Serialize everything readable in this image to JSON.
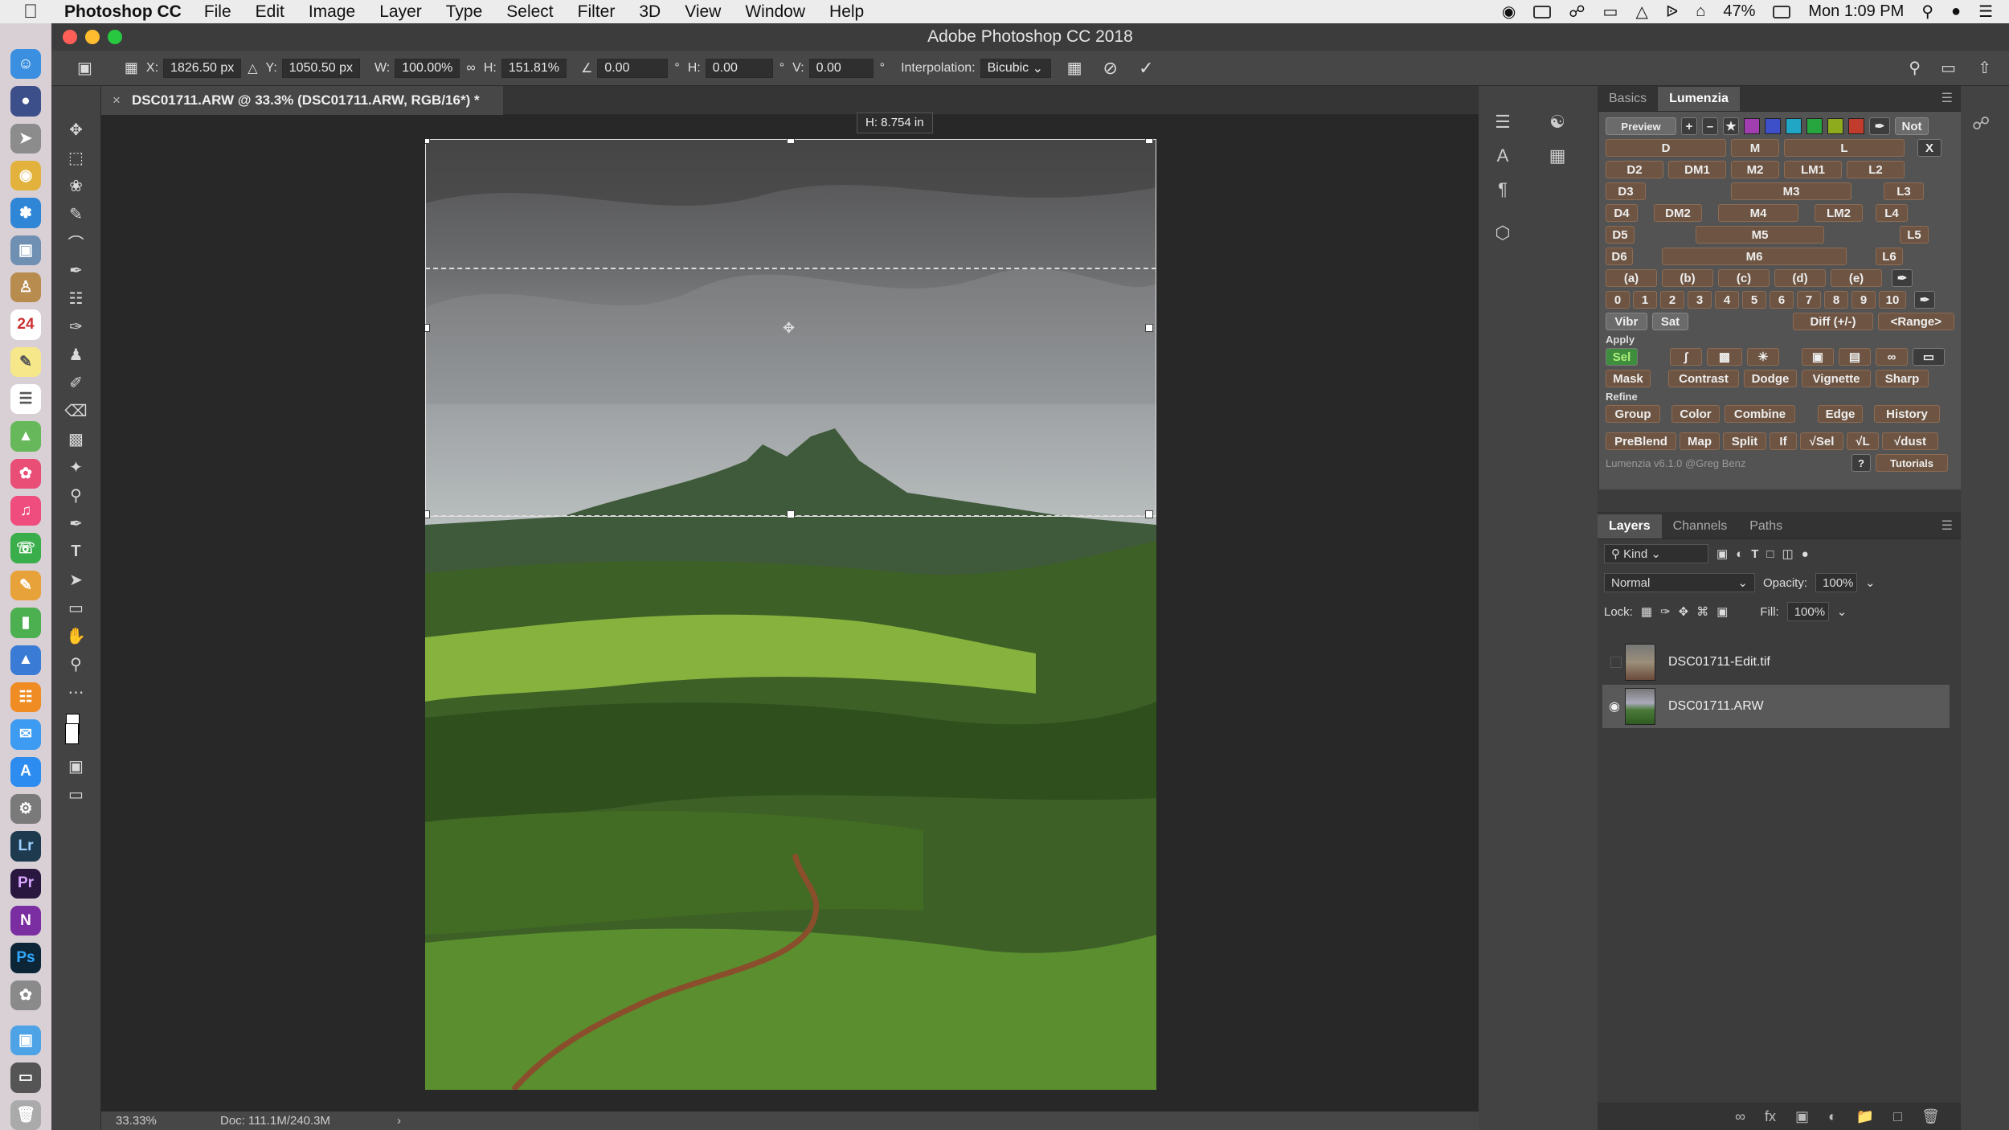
{
  "menubar": {
    "app": "Photoshop CC",
    "items": [
      "File",
      "Edit",
      "Image",
      "Layer",
      "Type",
      "Select",
      "Filter",
      "3D",
      "View",
      "Window",
      "Help"
    ],
    "battery": "47%",
    "clock": "Mon 1:09 PM"
  },
  "window": {
    "title": "Adobe Photoshop CC 2018"
  },
  "options": {
    "x_label": "X:",
    "x_value": "1826.50 px",
    "y_label": "Y:",
    "y_value": "1050.50 px",
    "w_label": "W:",
    "w_value": "100.00%",
    "h_label": "H:",
    "h_value": "151.81%",
    "angle_value": "0.00",
    "hskew_label": "H:",
    "hskew_value": "0.00",
    "vskew_label": "V:",
    "vskew_value": "0.00",
    "interp_label": "Interpolation:",
    "interp_value": "Bicubic"
  },
  "doc_tab": {
    "label": "DSC01711.ARW @ 33.3% (DSC01711.ARW, RGB/16*) *"
  },
  "tooltip": "H: 8.754 in",
  "status": {
    "zoom": "33.33%",
    "doc": "Doc: 111.1M/240.3M"
  },
  "panel_tabs": [
    "Basics",
    "Lumenzia"
  ],
  "lumenzia": {
    "preview": "Preview",
    "not": "Not",
    "x": "X",
    "row1": [
      "D",
      "M",
      "L"
    ],
    "row2": [
      "D2",
      "DM1",
      "M2",
      "LM1",
      "L2"
    ],
    "row3": [
      "D3",
      "M3",
      "L3"
    ],
    "row4": [
      "D4",
      "DM2",
      "M4",
      "LM2",
      "L4"
    ],
    "row5": [
      "D5",
      "M5",
      "L5"
    ],
    "row6": [
      "D6",
      "M6",
      "L6"
    ],
    "zones": [
      "(a)",
      "(b)",
      "(c)",
      "(d)",
      "(e)"
    ],
    "nums": [
      "0",
      "1",
      "2",
      "3",
      "4",
      "5",
      "6",
      "7",
      "8",
      "9",
      "10"
    ],
    "vibr": "Vibr",
    "sat": "Sat",
    "diff": "Diff (+/-)",
    "range": "<Range>",
    "apply_label": "Apply",
    "sel": "Sel",
    "apply2": [
      "Mask",
      "Contrast",
      "Dodge",
      "Vignette",
      "Sharp"
    ],
    "refine_label": "Refine",
    "refine": [
      "Group",
      "Color",
      "Combine",
      "Edge",
      "History"
    ],
    "bottom": [
      "PreBlend",
      "Map",
      "Split",
      "If",
      "√Sel",
      "√L",
      "√dust"
    ],
    "version": "Lumenzia v6.1.0 @Greg Benz",
    "help": "?",
    "tutorials": "Tutorials",
    "colors": [
      "#a23fb0",
      "#3d4fc9",
      "#21a6c6",
      "#27a53e",
      "#8dab1d",
      "#c23c2e"
    ]
  },
  "layers_panel": {
    "tabs": [
      "Layers",
      "Channels",
      "Paths"
    ],
    "kind": "Kind",
    "blend": "Normal",
    "opacity_label": "Opacity:",
    "opacity": "100%",
    "lock_label": "Lock:",
    "fill_label": "Fill:",
    "fill": "100%",
    "layers": [
      {
        "name": "DSC01711-Edit.tif"
      },
      {
        "name": "DSC01711.ARW"
      }
    ]
  }
}
